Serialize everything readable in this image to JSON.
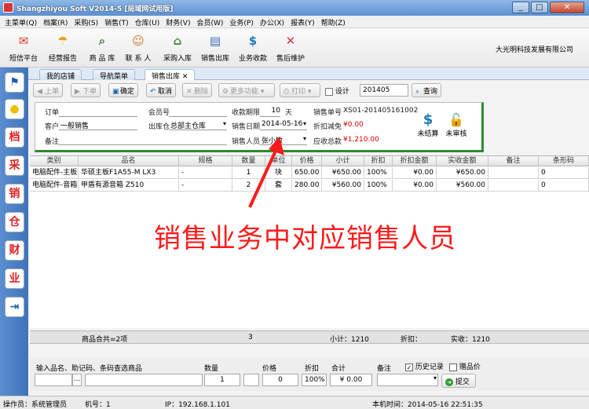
{
  "window": {
    "title": "Shangzhiyou Soft V2014-5 [局域网试用版]",
    "minimize": "_",
    "maximize": "□",
    "close": "✕"
  },
  "menubar": [
    "主菜单(Q)",
    "档案(R)",
    "采购(S)",
    "销售(T)",
    "仓库(U)",
    "财务(V)",
    "会员(W)",
    "业务(P)",
    "办公(X)",
    "报表(Y)",
    "帮助(Z)"
  ],
  "toolbar": {
    "buttons": [
      {
        "label": "短信平台",
        "icon": "sms-icon",
        "color": "#d83a2e",
        "glyph": "✉"
      },
      {
        "label": "经营报告",
        "icon": "report-icon",
        "color": "#e0a020",
        "glyph": "☂"
      },
      {
        "label": "商 品 库",
        "icon": "search-product-icon",
        "color": "#3a7a3a",
        "glyph": "⌕"
      },
      {
        "label": "联 系 人",
        "icon": "contact-icon",
        "color": "#d07020",
        "glyph": "☺"
      },
      {
        "label": "采购入库",
        "icon": "purchase-in-icon",
        "color": "#4a8a3a",
        "glyph": "⌂"
      },
      {
        "label": "销售出库",
        "icon": "sales-out-icon",
        "color": "#3a6ab8",
        "glyph": "▤"
      },
      {
        "label": "业务收款",
        "icon": "payment-icon",
        "color": "#1a7ab8",
        "glyph": "$"
      },
      {
        "label": "售后维护",
        "icon": "maintenance-icon",
        "color": "#c83a3a",
        "glyph": "✕"
      }
    ],
    "company": "大光明科技发展有限公司"
  },
  "sidebar": [
    {
      "icon": "flag-icon",
      "glyph": "⚑"
    },
    {
      "icon": "bulb-icon",
      "glyph": "●"
    },
    {
      "icon": "archive-icon",
      "glyph": "档"
    },
    {
      "icon": "purchase-icon",
      "glyph": "采"
    },
    {
      "icon": "sales-icon",
      "glyph": "销"
    },
    {
      "icon": "warehouse-icon",
      "glyph": "仓"
    },
    {
      "icon": "finance-icon",
      "glyph": "财"
    },
    {
      "icon": "business-icon",
      "glyph": "业"
    },
    {
      "icon": "exit-icon",
      "glyph": "⇥"
    }
  ],
  "tabs": [
    {
      "label": "我的店铺"
    },
    {
      "label": "导航菜单"
    },
    {
      "label": "销售出库",
      "close": "✕"
    }
  ],
  "actions": {
    "prev": "上单",
    "next": "下单",
    "confirm": "确定",
    "cancel": "取消",
    "delete": "删除",
    "more": "更多功能",
    "print": "打印",
    "design": "设计",
    "search_value": "201405",
    "query": "查询"
  },
  "form": {
    "order_label": "订单",
    "order_value": "",
    "member_label": "会员号",
    "member_value": "",
    "collect_days_label": "收款期限",
    "collect_days_value": "10",
    "collect_days_unit": "天",
    "sales_no_label": "销售单号",
    "sales_no_value": "XS01-201405161002",
    "customer_label": "客户",
    "customer_value": "一般销售",
    "warehouse_label": "出库仓",
    "warehouse_value": "总部主仓库",
    "sales_date_label": "销售日期",
    "sales_date_value": "2014-05-16",
    "discount_label": "折扣减免",
    "discount_value": "¥0.00",
    "remark_label": "备注",
    "remark_value": "",
    "salesperson_label": "销售人员",
    "salesperson_value": "张小敏",
    "receivable_label": "应收总款",
    "receivable_value": "¥1,210.00",
    "unsettled_label": "未结算",
    "unaudited_label": "未审核"
  },
  "grid": {
    "columns": [
      "类别",
      "品名",
      "规格",
      "数量",
      "单位",
      "价格",
      "小计",
      "折扣",
      "折扣金额",
      "实收金额",
      "备注",
      "条形码"
    ],
    "rows": [
      [
        "电脑配件-主板",
        "华硕主板F1A55-M LX3",
        "-",
        "1",
        "块",
        "650.00",
        "¥650.00",
        "100%",
        "¥0.00",
        "¥650.00",
        "",
        "0"
      ],
      [
        "电脑配件-音箱",
        "甲盾有源音箱 Z510",
        "-",
        "2",
        "套",
        "280.00",
        "¥560.00",
        "100%",
        "¥0.00",
        "¥560.00",
        "",
        "0"
      ]
    ]
  },
  "footer": {
    "count": "商品合共=2项",
    "qty": "3",
    "subtotal": "小计：1210",
    "discount": "折扣：",
    "actual": "实收：1210"
  },
  "entry": {
    "product_label": "输入品名、助记码、条码查选商品",
    "qty_label": "数量",
    "price_label": "价格",
    "discount_label": "折扣",
    "total_label": "合计",
    "remark_label": "备注",
    "history_label": "历史记录",
    "gift_label": "赠品价",
    "qty_value": "1",
    "price_value": "0",
    "discount_value": "100%",
    "total_value": "¥ 0.00",
    "dots": "...",
    "submit": "提交"
  },
  "status": {
    "operator": "操作员：系统管理员",
    "machine": "机号：1",
    "ip": "IP：192.168.1.101",
    "time": "本机时间：2014-05-16 22:51:35"
  },
  "annotation": {
    "text": "销售业务中对应销售人员",
    "color": "#ff1a1a"
  }
}
